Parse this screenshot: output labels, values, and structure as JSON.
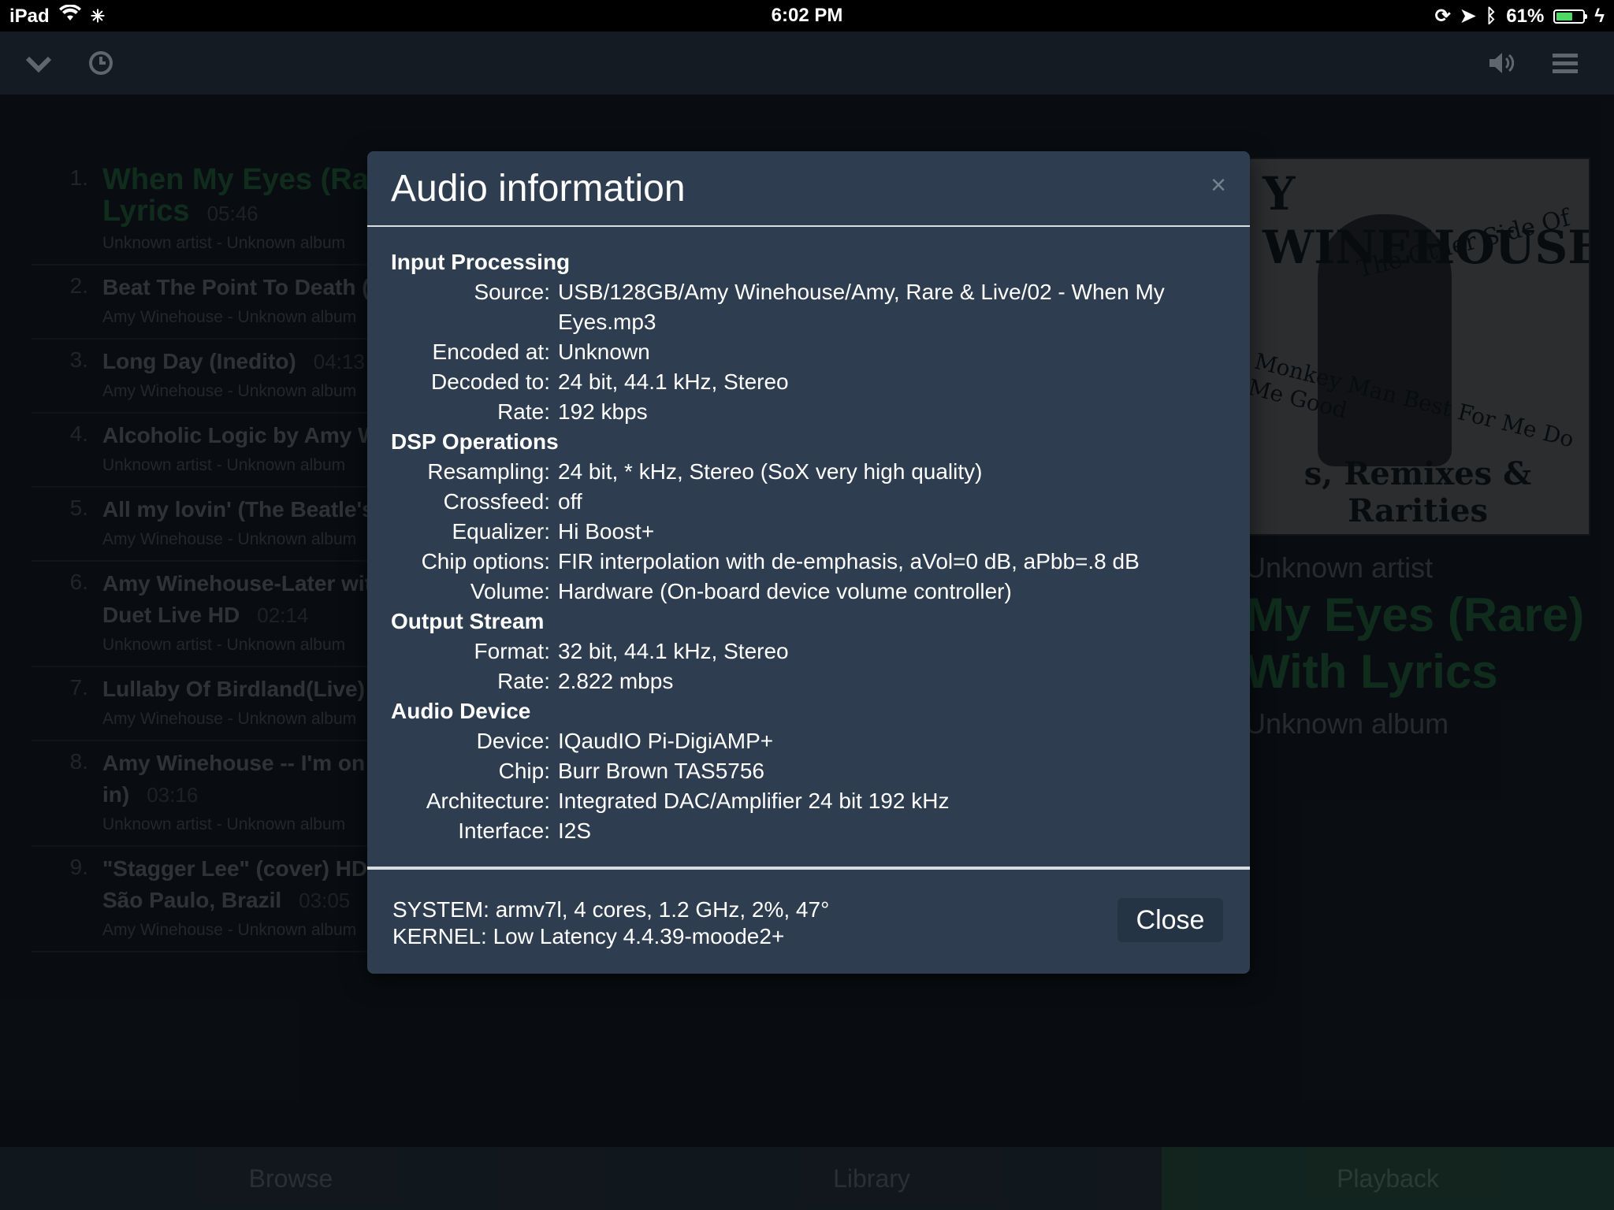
{
  "status_bar": {
    "device": "iPad",
    "time": "6:02 PM",
    "battery": "61%",
    "battery_level": 0.61
  },
  "toolbar": {
    "icons": [
      "chevron-down-icon",
      "clock-icon",
      "volume-icon",
      "menu-icon"
    ]
  },
  "playlist": [
    {
      "num": "1.",
      "title": "When My Eyes (Ra",
      "title2": "Lyrics",
      "duration": "05:46",
      "sub": "Unknown artist - Unknown album"
    },
    {
      "num": "2.",
      "title": "Beat The Point To Death (ly",
      "sub": "Amy Winehouse - Unknown album"
    },
    {
      "num": "3.",
      "title": "Long Day (Inedito)",
      "duration": "04:13",
      "sub": "Amy Winehouse - Unknown album"
    },
    {
      "num": "4.",
      "title": "Alcoholic Logic by Amy Wi",
      "sub": "Unknown artist - Unknown album"
    },
    {
      "num": "5.",
      "title": "All my lovin' (The Beatle's c",
      "sub": "Amy Winehouse - Unknown album"
    },
    {
      "num": "6.",
      "title": "Amy Winehouse-Later with",
      "title2": "Duet Live HD",
      "duration": "02:14",
      "sub": "Unknown artist - Unknown album"
    },
    {
      "num": "7.",
      "title": "Lullaby Of Birdland(Live)",
      "sub": "Amy Winehouse - Unknown album"
    },
    {
      "num": "8.",
      "title": "Amy Winehouse -- I'm on th",
      "title2": "in)",
      "duration": "03:16",
      "sub": "Unknown artist - Unknown album"
    },
    {
      "num": "9.",
      "title": "\"Stagger Lee\" (cover) HD @",
      "title2": "São Paulo, Brazil",
      "duration": "03:05",
      "sub": "Amy Winehouse - Unknown album"
    }
  ],
  "cover": {
    "top": "Y WINEHOUSE",
    "side": "The Other Side Of",
    "songs": "Monkey Man Best For Me Do Me Good",
    "bottom": "s, Remixes & Rarities"
  },
  "now_playing": {
    "artist": "Unknown artist",
    "title": "My Eyes (Rare) With Lyrics",
    "album": "Unknown album"
  },
  "tabs": [
    "Browse",
    "Library",
    "Playback"
  ],
  "modal": {
    "title": "Audio information",
    "close_x": "×",
    "sections": [
      {
        "heading": "Input Processing",
        "rows": [
          {
            "k": "Source:",
            "v": "USB/128GB/Amy Winehouse/Amy, Rare & Live/02 - When My Eyes.mp3"
          },
          {
            "k": "Encoded at:",
            "v": "Unknown"
          },
          {
            "k": "Decoded to:",
            "v": "24 bit, 44.1 kHz, Stereo"
          },
          {
            "k": "Rate:",
            "v": "192 kbps"
          }
        ]
      },
      {
        "heading": "DSP Operations",
        "rows": [
          {
            "k": "Resampling:",
            "v": "24 bit, * kHz, Stereo (SoX very high quality)"
          },
          {
            "k": "Crossfeed:",
            "v": "off"
          },
          {
            "k": "Equalizer:",
            "v": "Hi Boost+"
          },
          {
            "k": "Chip options:",
            "v": "FIR interpolation with de-emphasis, aVol=0 dB, aPbb=.8 dB"
          },
          {
            "k": "Volume:",
            "v": "Hardware (On-board device volume controller)"
          }
        ]
      },
      {
        "heading": "Output Stream",
        "rows": [
          {
            "k": "Format:",
            "v": "32 bit, 44.1 kHz, Stereo"
          },
          {
            "k": "Rate:",
            "v": "2.822 mbps"
          }
        ]
      },
      {
        "heading": "Audio Device",
        "rows": [
          {
            "k": "Device:",
            "v": "IQaudIO Pi-DigiAMP+"
          },
          {
            "k": "Chip:",
            "v": "Burr Brown TAS5756"
          },
          {
            "k": "Architecture:",
            "v": "Integrated DAC/Amplifier 24 bit 192 kHz"
          },
          {
            "k": "Interface:",
            "v": "I2S"
          }
        ]
      }
    ],
    "system": "SYSTEM: armv7l, 4 cores, 1.2 GHz, 2%, 47°",
    "kernel": "KERNEL: Low Latency 4.4.39-moode2+",
    "close_label": "Close"
  }
}
